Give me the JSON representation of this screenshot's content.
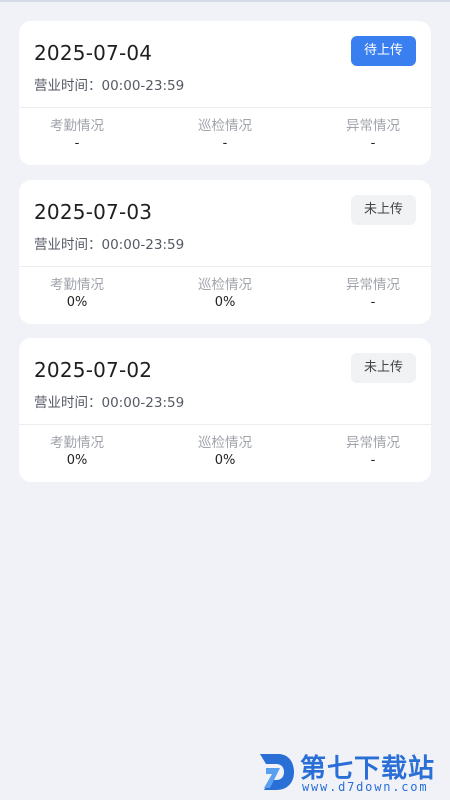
{
  "cards": [
    {
      "date": "2025-07-04",
      "hours": "营业时间：00:00-23:59",
      "status": "待上传",
      "stats": [
        {
          "label": "考勤情况",
          "value": "-"
        },
        {
          "label": "巡检情况",
          "value": "-"
        },
        {
          "label": "异常情况",
          "value": "-"
        }
      ]
    },
    {
      "date": "2025-07-03",
      "hours": "营业时间：00:00-23:59",
      "status": "未上传",
      "stats": [
        {
          "label": "考勤情况",
          "value": "0%"
        },
        {
          "label": "巡检情况",
          "value": "0%"
        },
        {
          "label": "异常情况",
          "value": "-"
        }
      ]
    },
    {
      "date": "2025-07-02",
      "hours": "营业时间：00:00-23:59",
      "status": "未上传",
      "stats": [
        {
          "label": "考勤情况",
          "value": "0%"
        },
        {
          "label": "巡检情况",
          "value": "0%"
        },
        {
          "label": "异常情况",
          "value": "-"
        }
      ]
    }
  ],
  "watermark": {
    "title": "第七下载站",
    "url": "www.d7down.com",
    "logo_icon": "d7-logo-icon",
    "color": "#2a6fd6"
  },
  "colors": {
    "background": "#f0f2f7",
    "pending_badge": "#3a7ff0",
    "none_badge": "#f1f2f4"
  }
}
